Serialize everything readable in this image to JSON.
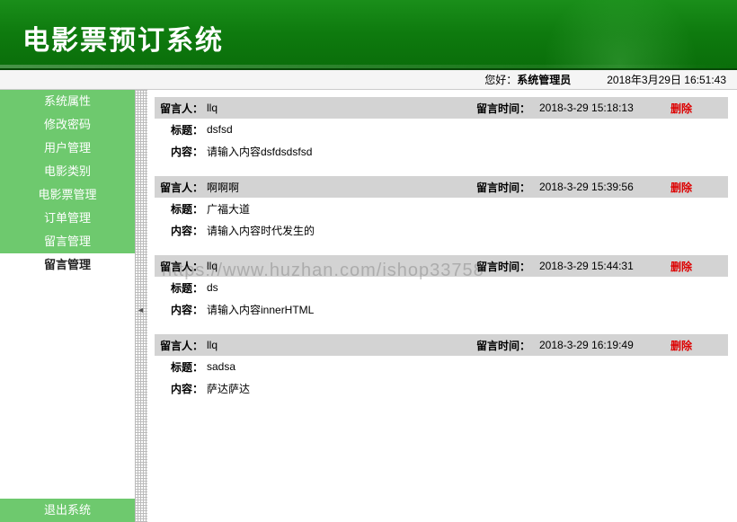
{
  "header": {
    "title": "电影票预订系统"
  },
  "topbar": {
    "greet_prefix": "您好：",
    "greet_user": "系统管理员",
    "datetime": "2018年3月29日 16:51:43"
  },
  "sidebar": {
    "items": [
      {
        "label": "系统属性"
      },
      {
        "label": "修改密码"
      },
      {
        "label": "用户管理"
      },
      {
        "label": "电影类别"
      },
      {
        "label": "电影票管理"
      },
      {
        "label": "订单管理"
      },
      {
        "label": "留言管理"
      },
      {
        "label": "留言管理",
        "active": true
      }
    ],
    "logout": "退出系统"
  },
  "labels": {
    "author": "留言人：",
    "time": "留言时间：",
    "title": "标题：",
    "content": "内容：",
    "delete": "删除"
  },
  "messages": [
    {
      "author": "llq",
      "time": "2018-3-29 15:18:13",
      "title": "dsfsd",
      "content": "请输入内容dsfdsdsfsd"
    },
    {
      "author": "啊啊啊",
      "time": "2018-3-29 15:39:56",
      "title": "广福大道",
      "content": "请输入内容时代发生的"
    },
    {
      "author": "llq",
      "time": "2018-3-29 15:44:31",
      "title": "ds",
      "content": "请输入内容innerHTML"
    },
    {
      "author": "llq",
      "time": "2018-3-29 16:19:49",
      "title": "sadsa",
      "content": "萨达萨达"
    }
  ],
  "watermark": "https://www.huzhan.com/ishop33758"
}
